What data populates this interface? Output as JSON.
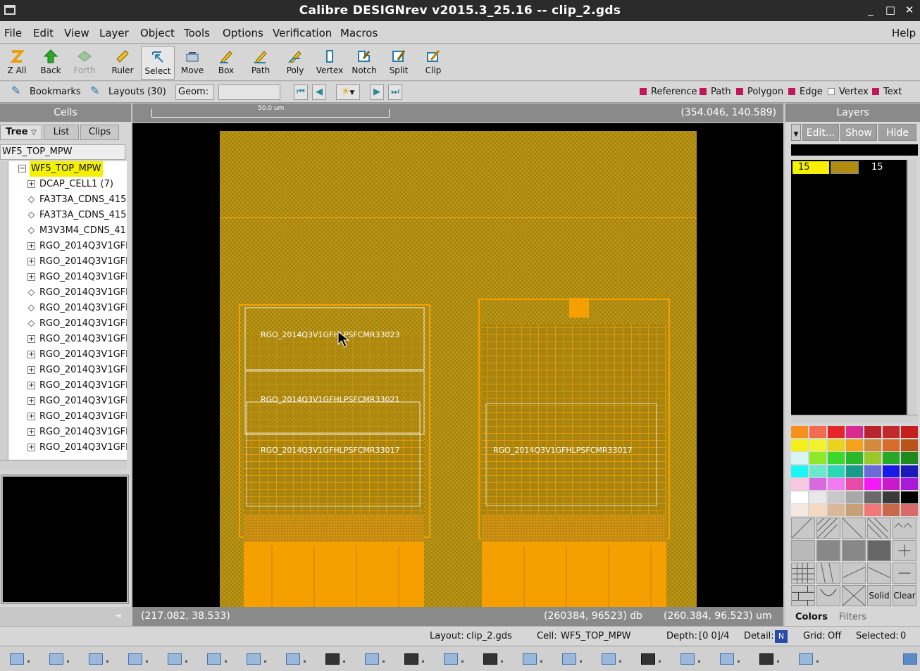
{
  "window": {
    "title": "Calibre DESIGNrev v2015.3_25.16  --  clip_2.gds",
    "minimize": "_",
    "maximize": "□",
    "close": "✕"
  },
  "menu": [
    "File",
    "Edit",
    "View",
    "Layer",
    "Object",
    "Tools",
    "Options",
    "Verification",
    "Macros"
  ],
  "help": "Help",
  "toolbar": [
    {
      "label": "Z All",
      "icon": "zoom-all-icon"
    },
    {
      "label": "Back",
      "icon": "back-arrow-icon"
    },
    {
      "label": "Forth",
      "icon": "forth-arrow-icon"
    },
    {
      "label": "Ruler",
      "icon": "ruler-icon"
    },
    {
      "label": "Select",
      "icon": "select-cursor-icon"
    },
    {
      "label": "Move",
      "icon": "move-icon"
    },
    {
      "label": "Box",
      "icon": "box-pencil-icon"
    },
    {
      "label": "Path",
      "icon": "path-pencil-icon"
    },
    {
      "label": "Poly",
      "icon": "poly-pencil-icon"
    },
    {
      "label": "Vertex",
      "icon": "vertex-icon"
    },
    {
      "label": "Notch",
      "icon": "notch-icon"
    },
    {
      "label": "Split",
      "icon": "split-icon"
    },
    {
      "label": "Clip",
      "icon": "clip-icon"
    }
  ],
  "toolbar2": {
    "bookmarks": "Bookmarks",
    "layouts": "Layouts (30)",
    "geom": "Geom:",
    "geom_value": "",
    "legend": [
      "Reference",
      "Path",
      "Polygon",
      "Edge",
      "Vertex",
      "Text"
    ]
  },
  "cells": {
    "header": "Cells",
    "tabs": [
      "Tree",
      "List",
      "Clips"
    ],
    "filter": "WF5_TOP_MPW",
    "root": "WF5_TOP_MPW",
    "items": [
      {
        "name": "DCAP_CELL1   (7)",
        "type": "expand"
      },
      {
        "name": "FA3T3A_CDNS_415",
        "type": "leaf"
      },
      {
        "name": "FA3T3A_CDNS_415",
        "type": "leaf"
      },
      {
        "name": "M3V3M4_CDNS_41",
        "type": "leaf"
      },
      {
        "name": "RGO_2014Q3V1GFI",
        "type": "expand"
      },
      {
        "name": "RGO_2014Q3V1GFI",
        "type": "expand"
      },
      {
        "name": "RGO_2014Q3V1GFI",
        "type": "expand"
      },
      {
        "name": "RGO_2014Q3V1GFI",
        "type": "leaf"
      },
      {
        "name": "RGO_2014Q3V1GFI",
        "type": "leaf"
      },
      {
        "name": "RGO_2014Q3V1GFI",
        "type": "leaf"
      },
      {
        "name": "RGO_2014Q3V1GFI",
        "type": "expand"
      },
      {
        "name": "RGO_2014Q3V1GFI",
        "type": "expand"
      },
      {
        "name": "RGO_2014Q3V1GFI",
        "type": "expand"
      },
      {
        "name": "RGO_2014Q3V1GFI",
        "type": "expand"
      },
      {
        "name": "RGO_2014Q3V1GFI",
        "type": "expand"
      },
      {
        "name": "RGO_2014Q3V1GFI",
        "type": "expand"
      },
      {
        "name": "RGO_2014Q3V1GFI",
        "type": "expand"
      },
      {
        "name": "RGO_2014Q3V1GFI",
        "type": "expand"
      }
    ]
  },
  "viewer": {
    "scale_label": "50.0 um",
    "cursor_coord": "(354.046, 140.589)",
    "labels": [
      "RGO_2014Q3V1GFHLPSFCMR33023",
      "RGO_2014Q3V1GFHLPSFCMR33021",
      "RGO_2014Q3V1GFHLPSFCMR33017",
      "RGO_2014Q3V1GFHLPSFCMR33017"
    ],
    "status_left": "(217.082, 38.533)",
    "status_db": "(260384, 96523) db",
    "status_um": "(260.384, 96.523) um"
  },
  "layers": {
    "header": "Layers",
    "edit": "Edit...",
    "show": "Show",
    "hide": "Hide",
    "entries": [
      {
        "number": "15",
        "name": "15"
      }
    ],
    "tabs": [
      "Colors",
      "Filters"
    ],
    "solid": "Solid",
    "clear": "Clear",
    "palette": [
      "#f5901e",
      "#f26b4f",
      "#e8242b",
      "#d92a8f",
      "#b8252f",
      "#c12a2a",
      "#c41e1e",
      "#f5f01a",
      "#f2f22a",
      "#e8d41a",
      "#f5a21a",
      "#d48a3a",
      "#d86a2a",
      "#b8541a",
      "#d8f5f5",
      "#8ee82a",
      "#3ad82a",
      "#2ab82a",
      "#9ac82a",
      "#28a828",
      "#1e8a1e",
      "#1af5f5",
      "#6ae8d0",
      "#2ad8b8",
      "#1a9a8a",
      "#6a6ad8",
      "#1a1ae8",
      "#1a1ab8",
      "#f5c8e0",
      "#d86ae0",
      "#f07af0",
      "#e84aa8",
      "#f51af5",
      "#c81ac8",
      "#a81ad8",
      "#ffffff",
      "#e8e8e8",
      "#c8c8c8",
      "#a8a8a8",
      "#6a6a6a",
      "#3a3a3a",
      "#000000",
      "#f5e8e0",
      "#f5d8c0",
      "#d8b898",
      "#c8a078",
      "#f07878",
      "#c86a4a",
      "#d86a6a"
    ]
  },
  "status": {
    "layout_label": "Layout:",
    "layout": "clip_2.gds",
    "cell_label": "Cell:",
    "cell": "WF5_TOP_MPW",
    "depth_label": "Depth:",
    "depth": "[0 0]/4",
    "detail_label": "Detail:",
    "grid_label": "Grid:",
    "grid": "Off",
    "selected_label": "Selected:",
    "selected": "0"
  }
}
